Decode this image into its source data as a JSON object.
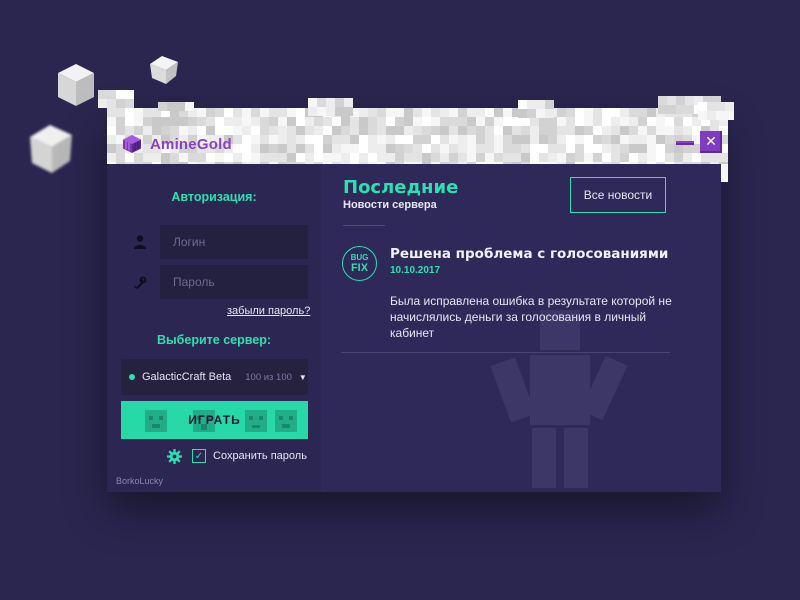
{
  "app": {
    "title": "AmineGold"
  },
  "window_controls": {
    "minimize_icon": "minimize-icon",
    "close_glyph": "✕"
  },
  "auth": {
    "heading": "Авторизация:",
    "login_placeholder": "Логин",
    "password_placeholder": "Пароль",
    "forgot_label": "забыли пароль?"
  },
  "server": {
    "heading": "Выберите сервер:",
    "selected_name": "GalacticCraft Beta",
    "selected_count": "100 из 100",
    "caret": "▼"
  },
  "play": {
    "label": "ИГРАТЬ"
  },
  "options": {
    "save_password_label": "Сохранить пароль",
    "save_password_checked": true,
    "check_glyph": "✓"
  },
  "footer": {
    "author": "BorkoLucky"
  },
  "news": {
    "heading": "Последние",
    "subheading": "Новости сервера",
    "all_news_label": "Все новости",
    "post": {
      "badge_top": "BUG",
      "badge_bottom": "FIX",
      "title": "Решена проблема с голосованиями",
      "date": "10.10.2017",
      "body": "Была исправлена ошибка в результате которой не начислялись деньги за голосования в личный кабинет"
    }
  },
  "colors": {
    "background": "#2b2650",
    "accent": "#2de0b1",
    "brand": "#8a3fc9",
    "panel": "#2c2752"
  }
}
